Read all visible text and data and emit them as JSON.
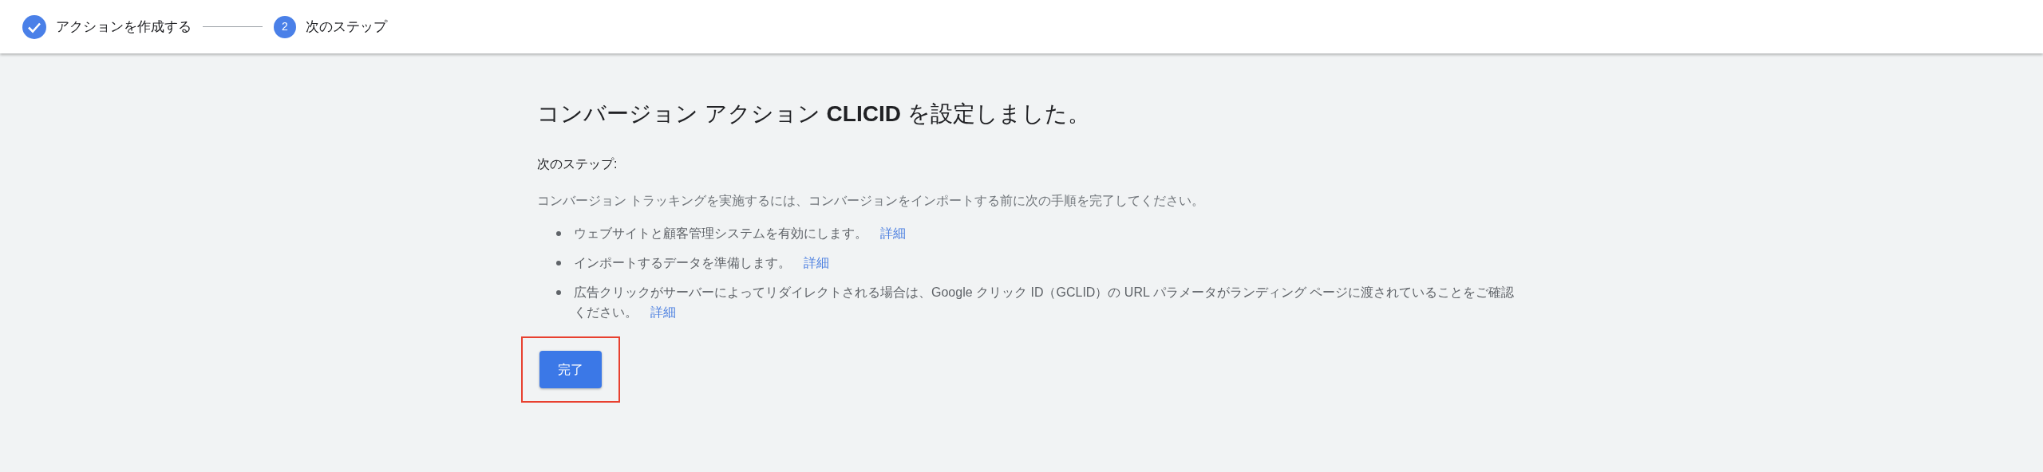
{
  "stepper": [
    {
      "label": "アクションを作成する",
      "completed": true
    },
    {
      "label": "次のステップ",
      "completed": false,
      "number": "2"
    }
  ],
  "title": "コンバージョン アクション **CLICID** を設定しました。",
  "subheading": "次のステップ:",
  "description": "コンバージョン トラッキングを実施するには、コンバージョンをインポートする前に次の手順を完了してください。",
  "steps": [
    {
      "text": "ウェブサイトと顧客管理システムを有効にします。",
      "link": "詳細"
    },
    {
      "text": "インポートするデータを準備します。",
      "link": "詳細"
    },
    {
      "text": "広告クリックがサーバーによってリダイレクトされる場合は、Google クリック ID（GCLID）の URL パラメータがランディング ページに渡されていることをご確認ください。",
      "link": "詳細"
    }
  ],
  "done_button": {
    "label": "完了",
    "highlighted": true
  }
}
